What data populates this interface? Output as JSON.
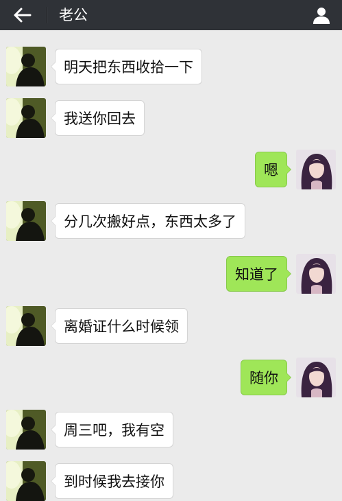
{
  "header": {
    "title": "老公",
    "back_icon": "arrow-left-icon",
    "profile_icon": "person-icon"
  },
  "colors": {
    "header_bg": "#2f3237",
    "chat_bg": "#ebebeb",
    "incoming_bubble": "#ffffff",
    "outgoing_bubble": "#9fe658"
  },
  "messages": [
    {
      "sender": "husband",
      "text": "明天把东西收拾一下"
    },
    {
      "sender": "husband",
      "text": "我送你回去"
    },
    {
      "sender": "me",
      "text": "嗯"
    },
    {
      "sender": "husband",
      "text": "分几次搬好点，东西太多了"
    },
    {
      "sender": "me",
      "text": "知道了"
    },
    {
      "sender": "husband",
      "text": "离婚证什么时候领"
    },
    {
      "sender": "me",
      "text": "随你"
    },
    {
      "sender": "husband",
      "text": "周三吧，我有空"
    },
    {
      "sender": "husband",
      "text": "到时候我去接你"
    }
  ]
}
